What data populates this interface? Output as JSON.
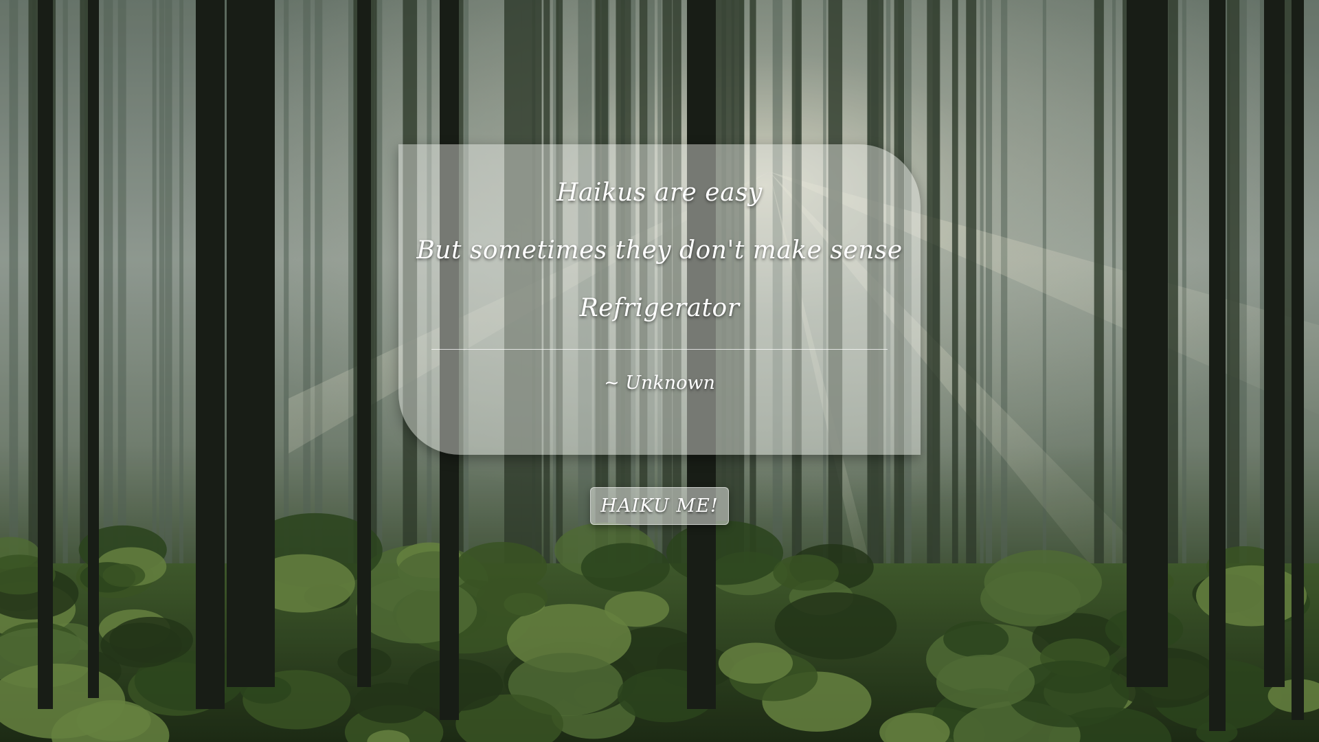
{
  "haiku": {
    "lines": [
      "Haikus are easy",
      "But sometimes they don't make sense",
      "Refrigerator"
    ],
    "author": "~ Unknown"
  },
  "action": {
    "button_label": "HAIKU ME!"
  },
  "background": {
    "icon": "forest-background-image",
    "colors": {
      "foliage": "#2f4a2c",
      "trunk": "#1c2119",
      "haze": "#c9cfc9",
      "ground": "#4f6a2c"
    }
  }
}
